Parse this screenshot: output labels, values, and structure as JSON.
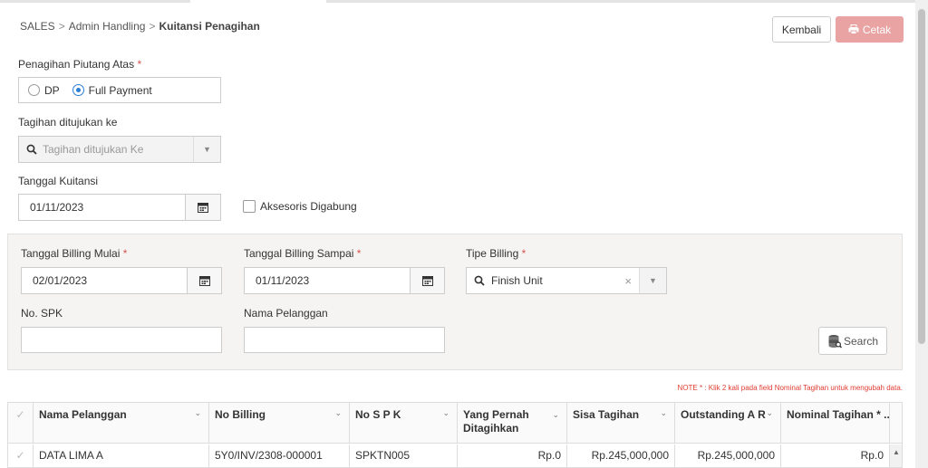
{
  "breadcrumb": {
    "items": [
      "SALES",
      "Admin Handling"
    ],
    "current": "Kuitansi Penagihan",
    "separator": ">"
  },
  "header_actions": {
    "back_label": "Kembali",
    "print_label": "Cetak"
  },
  "payment_type": {
    "label": "Penagihan Piutang Atas",
    "required_mark": "*",
    "options": [
      {
        "label": "DP",
        "selected": false
      },
      {
        "label": "Full Payment",
        "selected": true
      }
    ]
  },
  "billed_to": {
    "label": "Tagihan ditujukan ke",
    "placeholder": "Tagihan ditujukan Ke"
  },
  "receipt_date": {
    "label": "Tanggal Kuitansi",
    "value": "01/11/2023"
  },
  "accessories": {
    "label": "Aksesoris Digabung",
    "checked": false
  },
  "filters": {
    "billing_start": {
      "label": "Tanggal Billing Mulai",
      "required_mark": "*",
      "value": "02/01/2023"
    },
    "billing_end": {
      "label": "Tanggal Billing Sampai",
      "required_mark": "*",
      "value": "01/11/2023"
    },
    "billing_type": {
      "label": "Tipe Billing",
      "required_mark": "*",
      "value": "Finish Unit",
      "clear_glyph": "×"
    },
    "spk_no": {
      "label": "No. SPK",
      "value": ""
    },
    "customer_name": {
      "label": "Nama Pelanggan",
      "value": ""
    },
    "search_label": "Search"
  },
  "note": "NOTE * : Klik 2 kali pada field Nominal Tagihan untuk mengubah data.",
  "table": {
    "columns": [
      "Nama Pelanggan",
      "No Billing",
      "No S P K",
      "Yang Pernah Ditagihkan",
      "Sisa Tagihan",
      "Outstanding A R",
      "Nominal Tagihan * ..."
    ],
    "rows": [
      {
        "customer": "DATA LIMA A",
        "billing_no": "5Y0/INV/2308-000001",
        "spk_no": "SPKTN005",
        "billed": "Rp.0",
        "remaining": "Rp.245,000,000",
        "outstanding": "Rp.245,000,000",
        "nominal": "Rp.0"
      }
    ]
  },
  "colors": {
    "accent": "#2a7dd6",
    "print_button": "#e9a3a3",
    "required": "#d9534f",
    "note": "#e03c31"
  }
}
